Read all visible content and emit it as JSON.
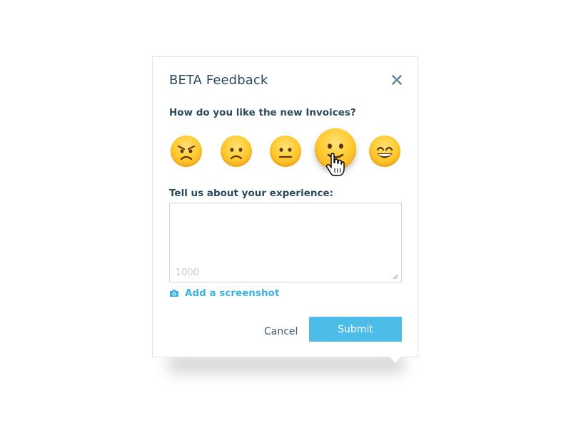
{
  "dialog": {
    "title": "BETA Feedback",
    "close_icon": "close-icon",
    "question": "How do you like the new Invoices?",
    "ratings": [
      {
        "name": "angry",
        "selected": false
      },
      {
        "name": "sad",
        "selected": false
      },
      {
        "name": "neutral",
        "selected": false
      },
      {
        "name": "slight-smile",
        "selected": true
      },
      {
        "name": "happy",
        "selected": false
      }
    ],
    "experience_label": "Tell us about your experience:",
    "textarea_value": "",
    "char_counter": "1000",
    "screenshot_label": "Add a screenshot",
    "screenshot_icon": "camera-icon",
    "cancel_label": "Cancel",
    "submit_label": "Submit"
  },
  "colors": {
    "accent": "#4cbde8",
    "link": "#3db3e3",
    "text": "#2c4a5e",
    "emoji": "#ffcc33"
  }
}
